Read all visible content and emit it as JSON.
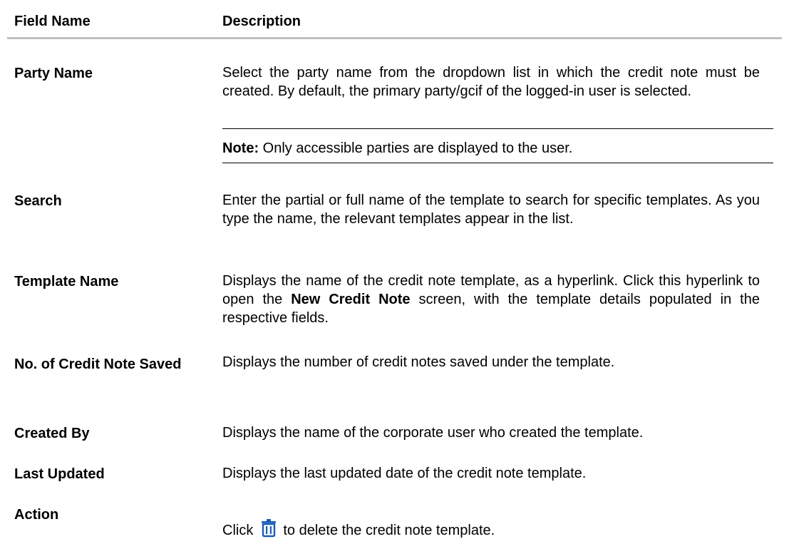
{
  "header": {
    "col1": "Field Name",
    "col2": "Description"
  },
  "rows": {
    "party_name": {
      "name": "Party Name",
      "desc": "Select the party name from the dropdown list in which the credit note must be created. By default, the primary party/gcif of the logged-in user is selected.",
      "note_label": "Note:",
      "note_text": "Only accessible parties are displayed to the user."
    },
    "search": {
      "name": "Search",
      "desc": "Enter the partial or full name of the template to search for specific templates. As you type the name, the relevant templates appear in the list."
    },
    "template_name": {
      "name": "Template Name",
      "desc_a": "Displays the name of the credit note template, as a hyperlink. Click this hyperlink to open the ",
      "desc_bold": "New Credit Note",
      "desc_b": " screen, with the template details populated in the respective fields."
    },
    "no_saved": {
      "name": "No. of Credit Note Saved",
      "desc": "Displays the number of credit notes saved under the template."
    },
    "created_by": {
      "name": "Created By",
      "desc": "Displays the name of the corporate user who created the template."
    },
    "last_updated": {
      "name": "Last Updated",
      "desc": "Displays the last updated date of the credit note template."
    },
    "action": {
      "name": "Action",
      "desc_a": "Click",
      "icon": "trash-icon",
      "desc_b": "to delete the credit note template."
    }
  },
  "colors": {
    "icon": "#1a5bb8",
    "header_rule": "#bfbfbf"
  }
}
